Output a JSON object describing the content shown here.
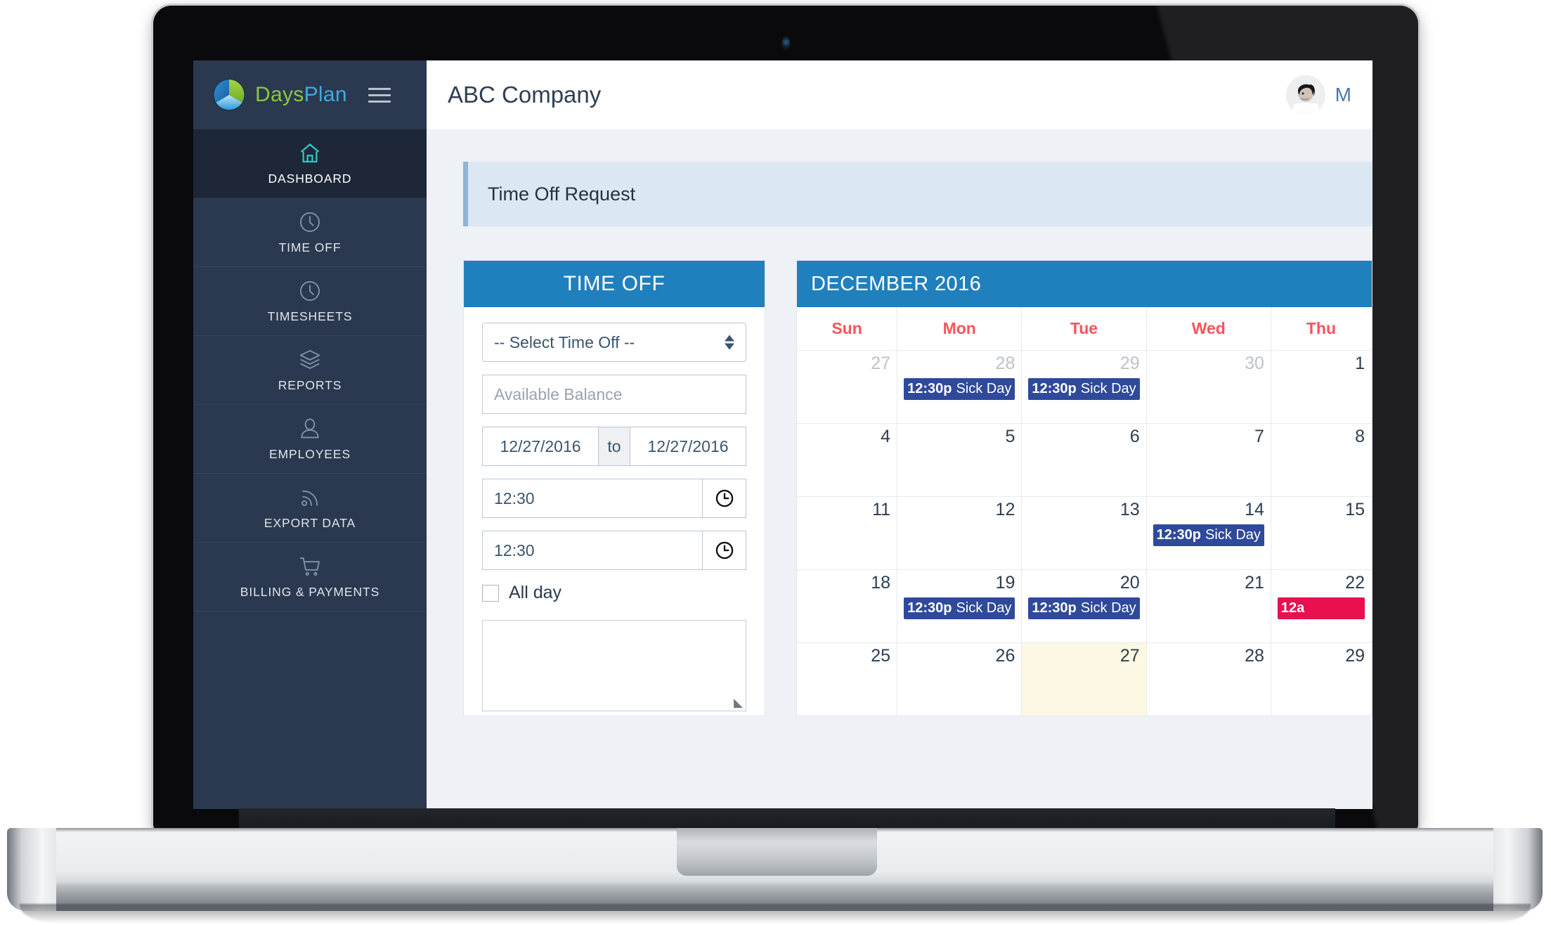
{
  "brand": {
    "days": "Days",
    "plan": "Plan",
    "logo_icon": "pie-chart-logo-icon",
    "menu_icon": "hamburger-menu-icon"
  },
  "sidebar": {
    "items": [
      {
        "label": "DASHBOARD",
        "icon": "home-icon",
        "active": true
      },
      {
        "label": "TIME OFF",
        "icon": "clock-icon",
        "active": false
      },
      {
        "label": "TIMESHEETS",
        "icon": "clock-icon",
        "active": false
      },
      {
        "label": "REPORTS",
        "icon": "layers-icon",
        "active": false
      },
      {
        "label": "EMPLOYEES",
        "icon": "user-icon",
        "active": false
      },
      {
        "label": "EXPORT DATA",
        "icon": "rss-icon",
        "active": false
      },
      {
        "label": "BILLING & PAYMENTS",
        "icon": "shopping-cart-icon",
        "active": false
      }
    ]
  },
  "topbar": {
    "company": "ABC Company",
    "user_name": "M",
    "avatar_icon": "user-photo-avatar"
  },
  "alert": {
    "text": "Time Off Request"
  },
  "timeoff_form": {
    "title": "TIME OFF",
    "select_placeholder": "-- Select Time Off --",
    "balance_placeholder": "Available Balance",
    "date_from": "12/27/2016",
    "date_to_label": "to",
    "date_to": "12/27/2016",
    "time_start": "12:30",
    "time_end": "12:30",
    "clock_icon": "clock-icon",
    "allday_label": "All day",
    "allday_checked": false,
    "notes_value": ""
  },
  "calendar": {
    "title": "DECEMBER 2016",
    "dow": [
      "Sun",
      "Mon",
      "Tue",
      "Wed",
      "Thu"
    ],
    "accent": "#2080bd",
    "dow_color": "#f8545b",
    "event_blue": "#2f4a9b",
    "event_pink": "#e8104f",
    "today_bg": "#fcf8e3",
    "weeks": [
      [
        {
          "day": "27",
          "other": true,
          "today": false,
          "events": []
        },
        {
          "day": "28",
          "other": true,
          "today": false,
          "events": [
            {
              "time": "12:30p",
              "title": "Sick Day",
              "color": "blue"
            }
          ]
        },
        {
          "day": "29",
          "other": true,
          "today": false,
          "events": [
            {
              "time": "12:30p",
              "title": "Sick Day",
              "color": "blue"
            }
          ]
        },
        {
          "day": "30",
          "other": true,
          "today": false,
          "events": []
        },
        {
          "day": "1",
          "other": false,
          "today": false,
          "events": []
        }
      ],
      [
        {
          "day": "4",
          "other": false,
          "today": false,
          "events": []
        },
        {
          "day": "5",
          "other": false,
          "today": false,
          "events": []
        },
        {
          "day": "6",
          "other": false,
          "today": false,
          "events": []
        },
        {
          "day": "7",
          "other": false,
          "today": false,
          "events": []
        },
        {
          "day": "8",
          "other": false,
          "today": false,
          "events": []
        }
      ],
      [
        {
          "day": "11",
          "other": false,
          "today": false,
          "events": []
        },
        {
          "day": "12",
          "other": false,
          "today": false,
          "events": []
        },
        {
          "day": "13",
          "other": false,
          "today": false,
          "events": []
        },
        {
          "day": "14",
          "other": false,
          "today": false,
          "events": [
            {
              "time": "12:30p",
              "title": "Sick Day",
              "color": "blue"
            }
          ]
        },
        {
          "day": "15",
          "other": false,
          "today": false,
          "events": []
        }
      ],
      [
        {
          "day": "18",
          "other": false,
          "today": false,
          "events": []
        },
        {
          "day": "19",
          "other": false,
          "today": false,
          "events": [
            {
              "time": "12:30p",
              "title": "Sick Day",
              "color": "blue"
            }
          ]
        },
        {
          "day": "20",
          "other": false,
          "today": false,
          "events": [
            {
              "time": "12:30p",
              "title": "Sick Day",
              "color": "blue"
            }
          ]
        },
        {
          "day": "21",
          "other": false,
          "today": false,
          "events": []
        },
        {
          "day": "22",
          "other": false,
          "today": false,
          "events": [
            {
              "time": "12a",
              "title": "",
              "color": "pink"
            }
          ]
        }
      ],
      [
        {
          "day": "25",
          "other": false,
          "today": false,
          "events": []
        },
        {
          "day": "26",
          "other": false,
          "today": false,
          "events": []
        },
        {
          "day": "27",
          "other": false,
          "today": true,
          "events": []
        },
        {
          "day": "28",
          "other": false,
          "today": false,
          "events": []
        },
        {
          "day": "29",
          "other": false,
          "today": false,
          "events": []
        }
      ]
    ]
  },
  "device": {
    "type": "laptop",
    "webcam_icon": "webcam-icon"
  }
}
